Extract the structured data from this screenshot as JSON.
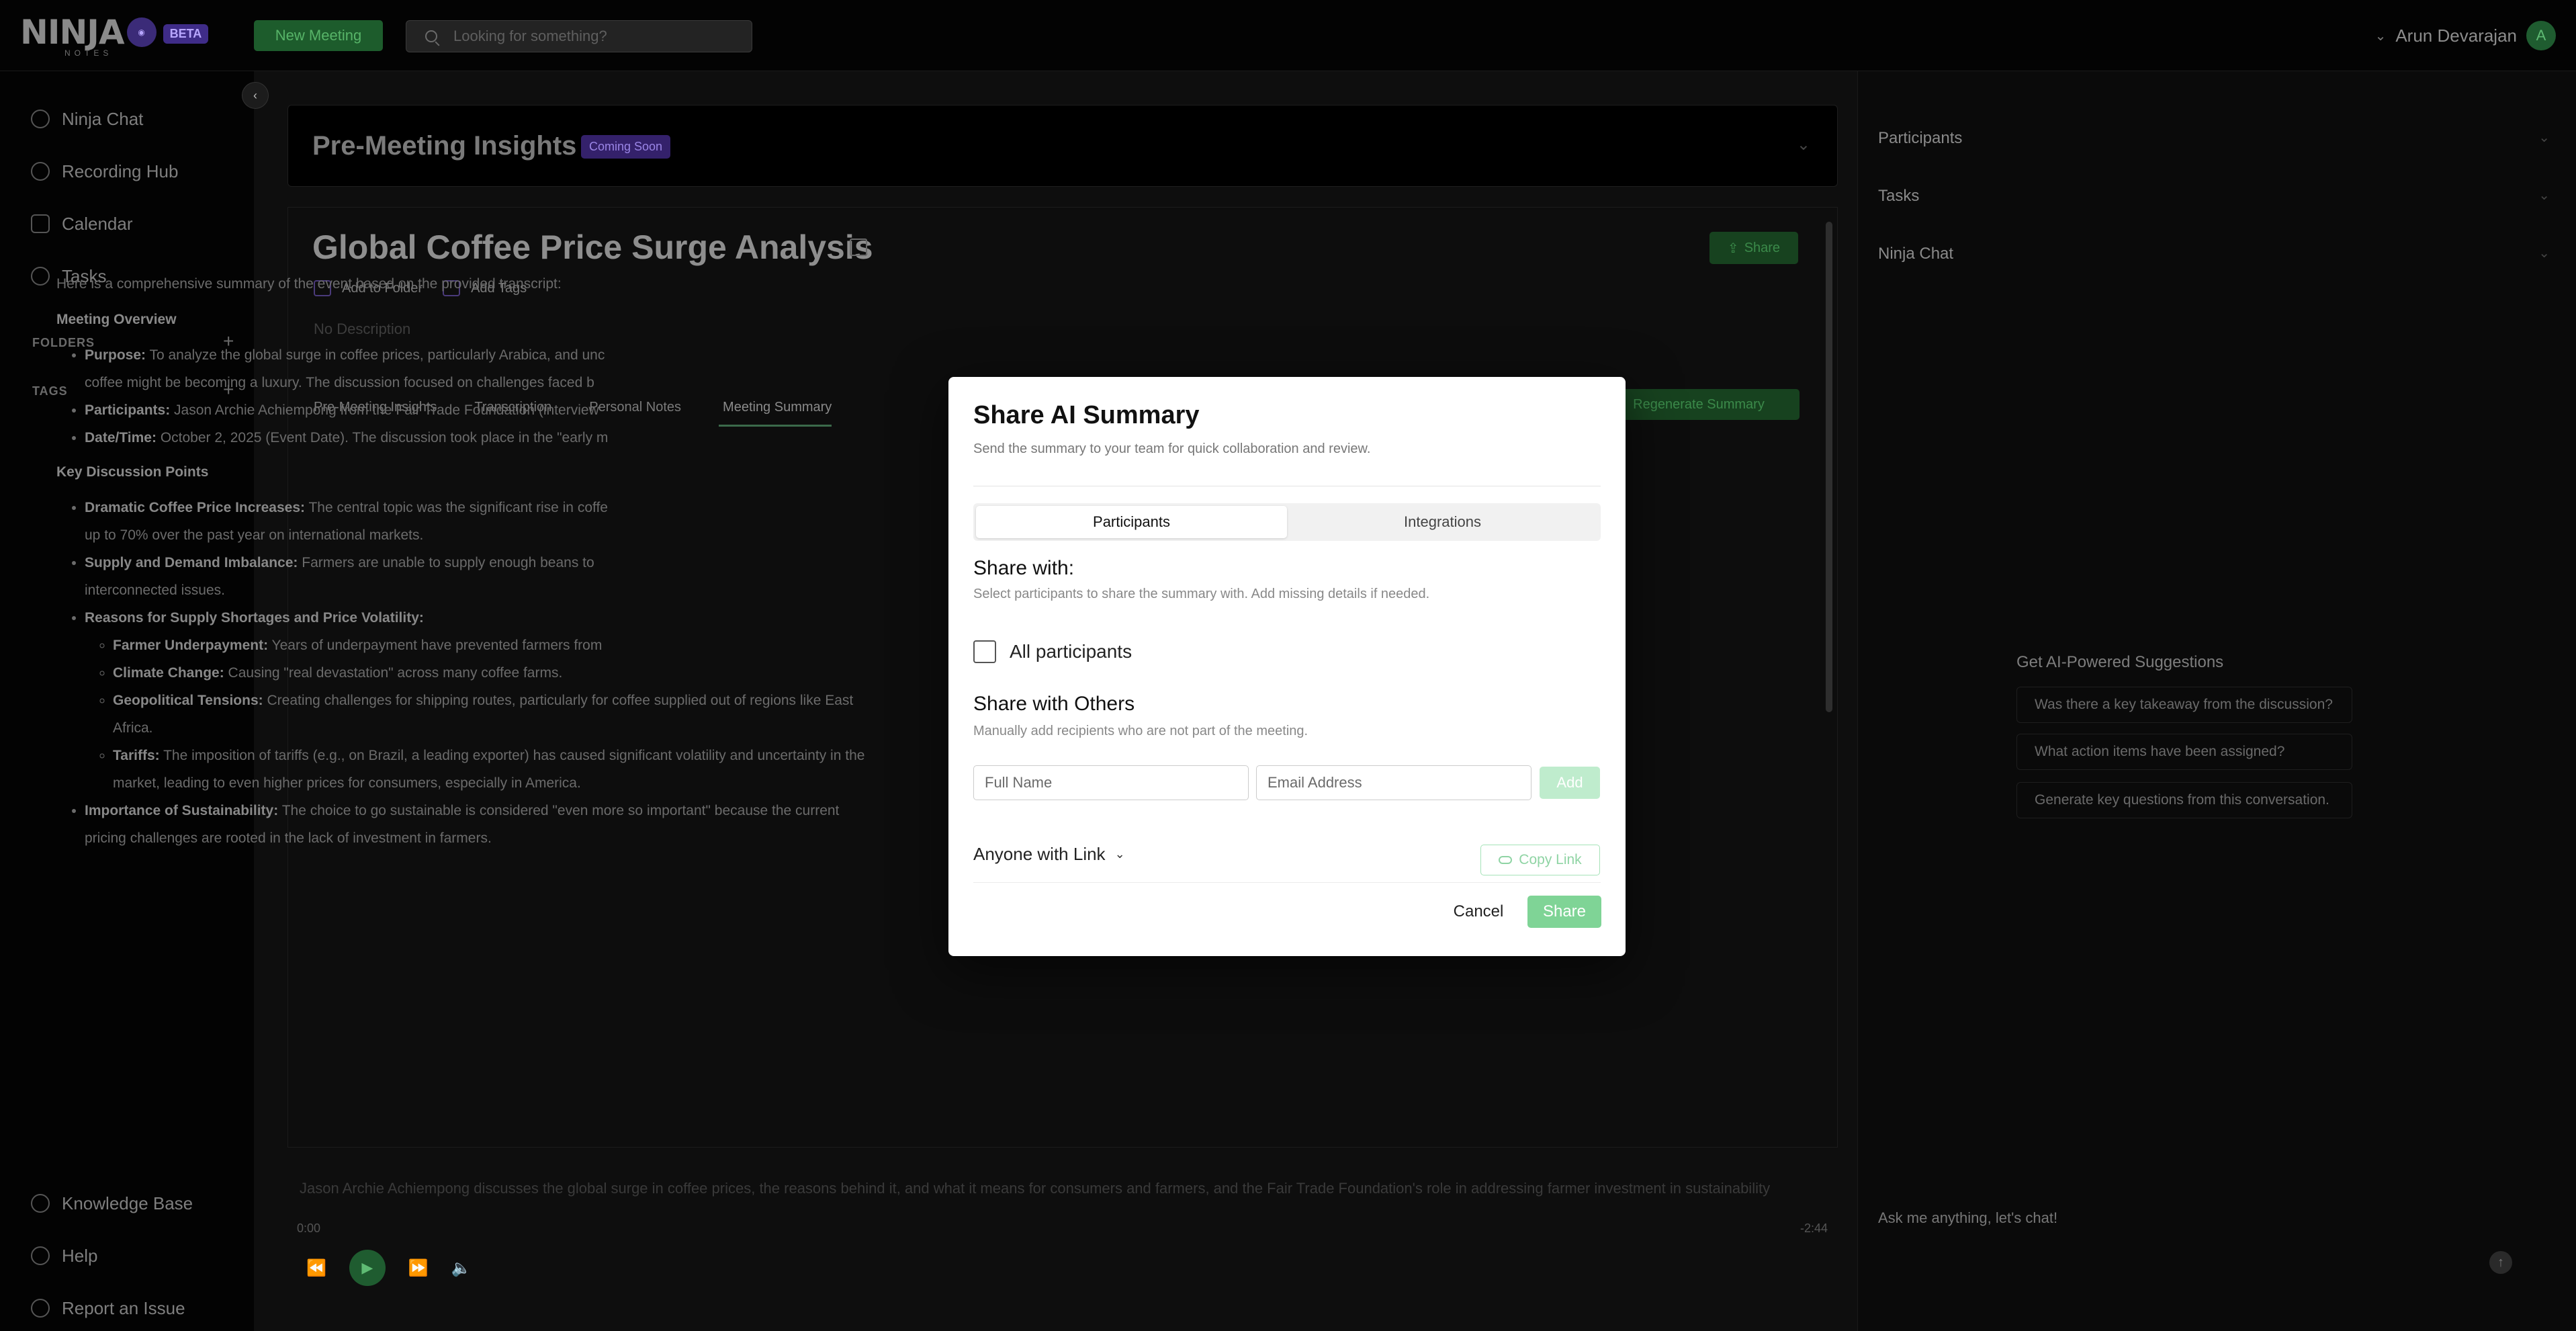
{
  "app": {
    "logo_text": "NINJA",
    "logo_sub": "NOTES",
    "beta_badge": "BETA",
    "new_meeting_label": "New Meeting",
    "search_placeholder": "Looking for something?",
    "user_name": "Arun Devarajan",
    "user_initial": "A"
  },
  "sidebar": {
    "items": [
      {
        "label": "Ninja Chat",
        "icon": "chat-icon"
      },
      {
        "label": "Recording Hub",
        "icon": "mic-icon"
      },
      {
        "label": "Calendar",
        "icon": "calendar-icon"
      },
      {
        "label": "Tasks",
        "icon": "tasks-icon"
      }
    ],
    "folders_label": "FOLDERS",
    "tags_label": "TAGS",
    "bottom": [
      {
        "label": "Knowledge Base",
        "icon": "book-icon"
      },
      {
        "label": "Help",
        "icon": "help-icon"
      },
      {
        "label": "Report an Issue",
        "icon": "alert-icon"
      }
    ]
  },
  "pre_meeting": {
    "title": "Pre-Meeting Insights",
    "badge": "Coming Soon"
  },
  "meeting": {
    "title": "Global Coffee Price Surge Analysis",
    "share_label": "Share",
    "add_folder": "Add to Folder",
    "add_tags": "Add Tags",
    "description": "No Description",
    "tabs": [
      "Pre-Meeting Insights",
      "Transcription",
      "Personal Notes",
      "Meeting Summary"
    ],
    "regen_label": "Regenerate Summary"
  },
  "summary": {
    "intro": "Here is a comprehensive summary of the event based on the provided transcript:",
    "overview_heading": "Meeting Overview",
    "purpose_label": "Purpose:",
    "purpose_text": "To analyze the global surge in coffee prices, particularly Arabica, and unc",
    "purpose_text2": "coffee might be becoming a luxury. The discussion focused on challenges faced b",
    "participants_label": "Participants:",
    "participants_text": "Jason Archie Achiempong from the Fair Trade Foundation (interview",
    "date_label": "Date/Time:",
    "date_text": "October 2, 2025 (Event Date). The discussion took place in the \"early m",
    "key_heading": "Key Discussion Points",
    "p1_label": "Dramatic Coffee Price Increases:",
    "p1_text": "The central topic was the significant rise in coffe",
    "p1_text2": "up to 70% over the past year on international markets.",
    "p2_label": "Supply and Demand Imbalance:",
    "p2_text": "Farmers are unable to supply enough beans to",
    "p2_text2": "interconnected issues.",
    "p3_label": "Reasons for Supply Shortages and Price Volatility:",
    "s1_label": "Farmer Underpayment:",
    "s1_text": "Years of underpayment have prevented farmers from",
    "s2_label": "Climate Change:",
    "s2_text": "Causing \"real devastation\" across many coffee farms.",
    "s3_label": "Geopolitical Tensions:",
    "s3_text": "Creating challenges for shipping routes, particularly for coffee supplied out of regions like East",
    "s3_text2": "Africa.",
    "s4_label": "Tariffs:",
    "s4_text": "The imposition of tariffs (e.g., on Brazil, a leading exporter) has caused significant volatility and uncertainty in the",
    "s4_text2": "market, leading to even higher prices for consumers, especially in America.",
    "p4_label": "Importance of Sustainability:",
    "p4_text": "The choice to go sustainable is considered \"even more so important\" because the current",
    "p4_text2": "pricing challenges are rooted in the lack of investment in farmers."
  },
  "player": {
    "transcript_line": "Jason Archie Achiempong discusses the global surge in coffee prices, the reasons behind it, and what it means for consumers and farmers, and the Fair Trade Foundation's role in addressing farmer investment in sustainability",
    "time_start": "0:00",
    "time_end": "-2:44"
  },
  "right_panel": {
    "sections": [
      "Participants",
      "Tasks",
      "Ninja Chat"
    ],
    "suggestions_title": "Get AI-Powered Suggestions",
    "suggestions": [
      "Was there a key takeaway from the discussion?",
      "What action items have been assigned?",
      "Generate key questions from this conversation."
    ],
    "chat_placeholder": "Ask me anything, let's chat!"
  },
  "modal": {
    "title": "Share AI Summary",
    "subtitle": "Send the summary to your team for quick collaboration and review.",
    "tabs": [
      "Participants",
      "Integrations"
    ],
    "share_with_heading": "Share with:",
    "share_with_note": "Select participants to share the summary with. Add missing details if needed.",
    "all_participants": "All participants",
    "others_heading": "Share with Others",
    "others_note": "Manually add recipients who are not part of the meeting.",
    "fullname_placeholder": "Full Name",
    "email_placeholder": "Email Address",
    "add_label": "Add",
    "anyone_label": "Anyone with Link",
    "copy_link_label": "Copy Link",
    "cancel_label": "Cancel",
    "share_label": "Share"
  },
  "colors": {
    "accent_green": "#1f5c30",
    "share_green": "#7fd496",
    "beta_purple": "#3f2c88"
  }
}
